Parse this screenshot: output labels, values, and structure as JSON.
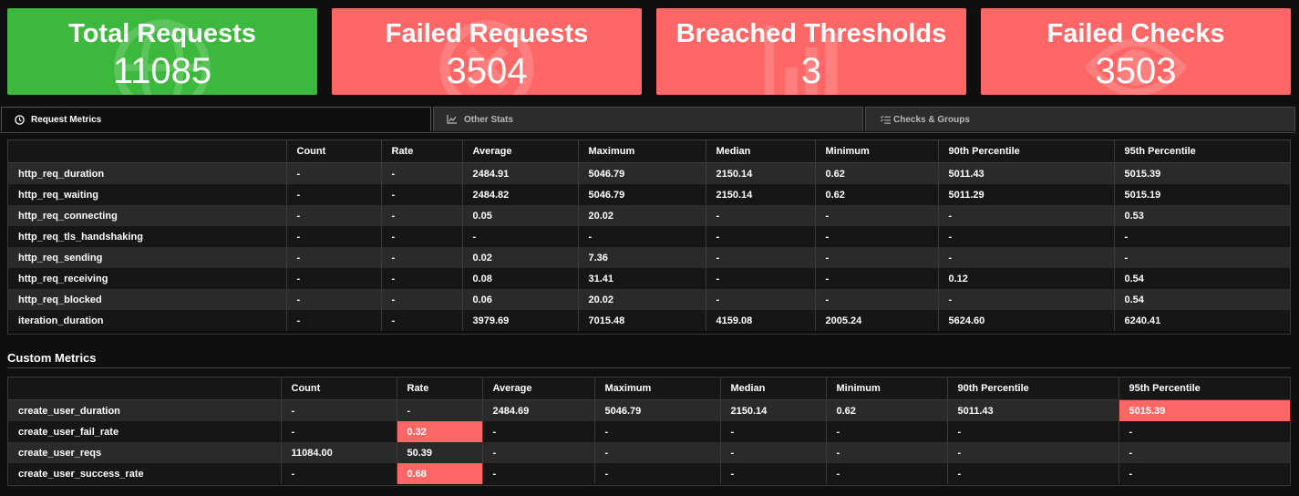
{
  "cards": [
    {
      "title": "Total Requests",
      "value": "11085",
      "color": "#3cb93c",
      "icon": "globe-icon"
    },
    {
      "title": "Failed Requests",
      "value": "3504",
      "color": "#ff6666",
      "icon": "x-circle-icon"
    },
    {
      "title": "Breached Thresholds",
      "value": "3",
      "color": "#ff6666",
      "icon": "bar-chart-icon"
    },
    {
      "title": "Failed Checks",
      "value": "3503",
      "color": "#ff6666",
      "icon": "eye-icon"
    }
  ],
  "tabs": [
    {
      "label": "Request Metrics",
      "icon": "clock-icon",
      "active": true
    },
    {
      "label": "Other Stats",
      "icon": "chart-icon",
      "active": false
    },
    {
      "label": "Checks & Groups",
      "icon": "list-check-icon",
      "active": false
    }
  ],
  "request_metrics": {
    "headers": [
      "",
      "Count",
      "Rate",
      "Average",
      "Maximum",
      "Median",
      "Minimum",
      "90th Percentile",
      "95th Percentile"
    ],
    "rows": [
      {
        "name": "http_req_duration",
        "count": "-",
        "rate": "-",
        "avg": "2484.91",
        "max": "5046.79",
        "med": "2150.14",
        "min": "0.62",
        "p90": "5011.43",
        "p95": "5015.39"
      },
      {
        "name": "http_req_waiting",
        "count": "-",
        "rate": "-",
        "avg": "2484.82",
        "max": "5046.79",
        "med": "2150.14",
        "min": "0.62",
        "p90": "5011.29",
        "p95": "5015.19"
      },
      {
        "name": "http_req_connecting",
        "count": "-",
        "rate": "-",
        "avg": "0.05",
        "max": "20.02",
        "med": "-",
        "min": "-",
        "p90": "-",
        "p95": "0.53"
      },
      {
        "name": "http_req_tls_handshaking",
        "count": "-",
        "rate": "-",
        "avg": "-",
        "max": "-",
        "med": "-",
        "min": "-",
        "p90": "-",
        "p95": "-"
      },
      {
        "name": "http_req_sending",
        "count": "-",
        "rate": "-",
        "avg": "0.02",
        "max": "7.36",
        "med": "-",
        "min": "-",
        "p90": "-",
        "p95": "-"
      },
      {
        "name": "http_req_receiving",
        "count": "-",
        "rate": "-",
        "avg": "0.08",
        "max": "31.41",
        "med": "-",
        "min": "-",
        "p90": "0.12",
        "p95": "0.54"
      },
      {
        "name": "http_req_blocked",
        "count": "-",
        "rate": "-",
        "avg": "0.06",
        "max": "20.02",
        "med": "-",
        "min": "-",
        "p90": "-",
        "p95": "0.54"
      },
      {
        "name": "iteration_duration",
        "count": "-",
        "rate": "-",
        "avg": "3979.69",
        "max": "7015.48",
        "med": "4159.08",
        "min": "2005.24",
        "p90": "5624.60",
        "p95": "6240.41"
      }
    ]
  },
  "custom_metrics": {
    "title": "Custom Metrics",
    "headers": [
      "",
      "Count",
      "Rate",
      "Average",
      "Maximum",
      "Median",
      "Minimum",
      "90th Percentile",
      "95th Percentile"
    ],
    "rows": [
      {
        "name": "create_user_duration",
        "count": "-",
        "rate": "-",
        "avg": "2484.69",
        "max": "5046.79",
        "med": "2150.14",
        "min": "0.62",
        "p90": "5011.43",
        "p95": "5015.39",
        "failed": [
          "p95"
        ]
      },
      {
        "name": "create_user_fail_rate",
        "count": "-",
        "rate": "0.32",
        "avg": "-",
        "max": "-",
        "med": "-",
        "min": "-",
        "p90": "-",
        "p95": "-",
        "failed": [
          "rate"
        ]
      },
      {
        "name": "create_user_reqs",
        "count": "11084.00",
        "rate": "50.39",
        "avg": "-",
        "max": "-",
        "med": "-",
        "min": "-",
        "p90": "-",
        "p95": "-",
        "failed": []
      },
      {
        "name": "create_user_success_rate",
        "count": "-",
        "rate": "0.68",
        "avg": "-",
        "max": "-",
        "med": "-",
        "min": "-",
        "p90": "-",
        "p95": "-",
        "failed": [
          "rate"
        ]
      }
    ]
  }
}
